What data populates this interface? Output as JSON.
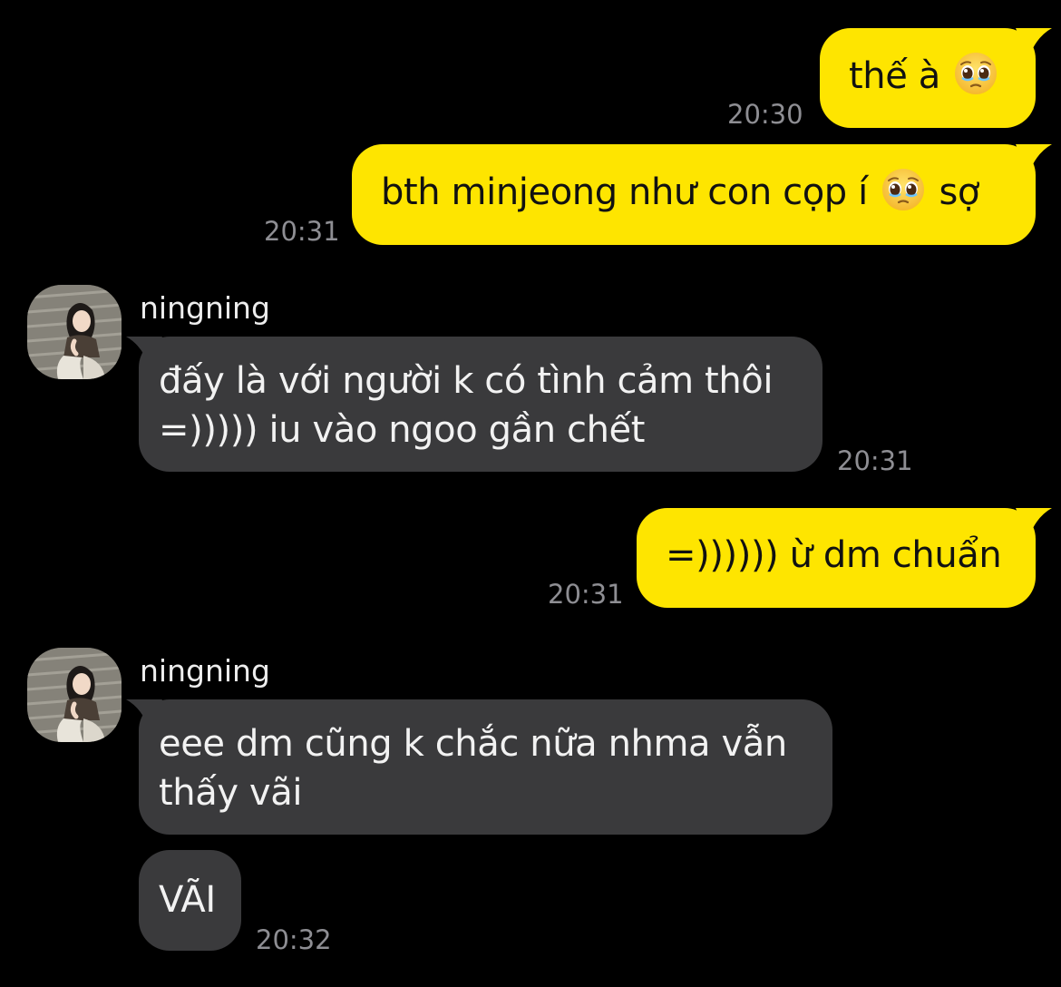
{
  "messages": [
    {
      "id": 1,
      "text_before": "thế à",
      "text_after": "",
      "emoji": "pleading-face",
      "time": "20:30",
      "sender": "me"
    },
    {
      "id": 2,
      "text_before": "bth minjeong như con cọp í",
      "text_after": "sợ",
      "emoji": "pleading-face",
      "time": "20:31",
      "sender": "me"
    },
    {
      "id": 3,
      "sender_name": "ningning",
      "line1": "đấy là với người k có tình cảm thôi",
      "line2": "=))))) iu vào ngoo gần chết",
      "time": "20:31",
      "sender": "other"
    },
    {
      "id": 4,
      "text": "=)))))) ừ dm chuẩn",
      "time": "20:31",
      "sender": "me"
    },
    {
      "id": 5,
      "sender_name": "ningning",
      "line1": "eee dm cũng k chắc nữa nhma vẫn",
      "line2": "thấy vãi",
      "time": "",
      "sender": "other"
    },
    {
      "id": 6,
      "text": "VÃI",
      "time": "20:32",
      "sender": "other"
    }
  ],
  "colors": {
    "background": "#000000",
    "outgoing_bubble": "#FEE500",
    "incoming_bubble": "#3A3A3C",
    "timestamp": "#8E8E93"
  },
  "icons": {
    "emoji": "pleading-face-emoji",
    "avatar": "contact-avatar"
  }
}
